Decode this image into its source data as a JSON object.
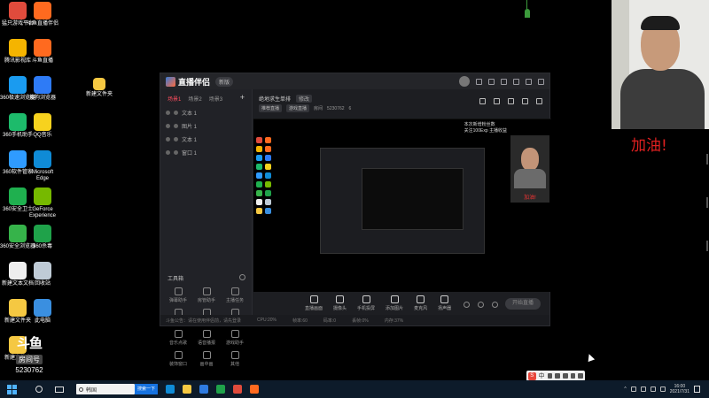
{
  "desktop_icons": [
    {
      "label": "猛只游戏平台",
      "color": "#e04b3c"
    },
    {
      "label": "斗鱼直播伴侣",
      "color": "#ff6a1f"
    },
    {
      "label": "腾讯影视库",
      "color": "#f5b400"
    },
    {
      "label": "斗鱼直播",
      "color": "#ff6a1f"
    },
    {
      "label": "360极速浏览器",
      "color": "#1a9bf0"
    },
    {
      "label": "搜狗浏览器",
      "color": "#2e7bf6"
    },
    {
      "label": "360手机助手",
      "color": "#1dbb6b"
    },
    {
      "label": "QQ音乐",
      "color": "#f7d21e"
    },
    {
      "label": "360软件管家",
      "color": "#2f9bff"
    },
    {
      "label": "Microsoft Edge",
      "color": "#0f8bd6"
    },
    {
      "label": "360安全卫士",
      "color": "#1fb04f"
    },
    {
      "label": "GeForce Experience",
      "color": "#76b900"
    },
    {
      "label": "360安全浏览器",
      "color": "#36b34a"
    },
    {
      "label": "360杀毒",
      "color": "#1fa24a"
    },
    {
      "label": "新建文本文档",
      "color": "#eeeeee"
    },
    {
      "label": "回收站",
      "color": "#bfcbd6"
    },
    {
      "label": "新建文件夹",
      "color": "#f5c842"
    },
    {
      "label": "此电脑",
      "color": "#3a8fe0"
    },
    {
      "label": "新建文件夹",
      "color": "#f5c842"
    }
  ],
  "extra_folder": {
    "label": "新建文件夹"
  },
  "app": {
    "logo": "直播伴侣",
    "version": "新版",
    "left_tabs": [
      "场景1",
      "场景2",
      "场景3"
    ],
    "add_label": "+",
    "scenes": [
      "文本 1",
      "图片 1",
      "文本 1",
      "窗口 1"
    ],
    "tools_title": "工具箱",
    "tools": [
      "弹幕助手",
      "房管助手",
      "主播任务",
      "抽奖设置",
      "更多设置",
      "摄像头",
      "音乐点歌",
      "语音播报",
      "游戏助手",
      "装饰窗口",
      "画中画",
      "其他"
    ],
    "room_title": "绝地求生单排",
    "room_chip": "修改",
    "room_tag1": "推荐直播",
    "room_tag2": "游戏直播",
    "room_id_label": "房间",
    "room_id": "5230762",
    "fans": "6",
    "preview_overlay_text1": "本次新增粉丝数",
    "preview_overlay_text2": "关注100Exp 主播收益",
    "streamer_cheer": "加油!",
    "bottom_items": [
      "直播画面",
      "摄像头",
      "手机投屏",
      "添加图片",
      "麦克风",
      "扬声器"
    ],
    "start_live": "开始直播",
    "status_items": [
      "斗鱼公告：请在使用伴侣前，请先登录",
      "CPU:20%",
      "帧率:60",
      "码率:0",
      "丢帧:0%",
      "内存:37%"
    ]
  },
  "cam_cheer": "加油!",
  "stream_brand": "斗鱼",
  "stream_room_label": "房间号",
  "stream_room_number": "5230762",
  "ime_label": "中",
  "taskbar": {
    "search_placeholder": "韩国",
    "search_button": "搜索一下",
    "time": "16:00",
    "date": "2021/7/31",
    "accent": "#1672e0"
  }
}
